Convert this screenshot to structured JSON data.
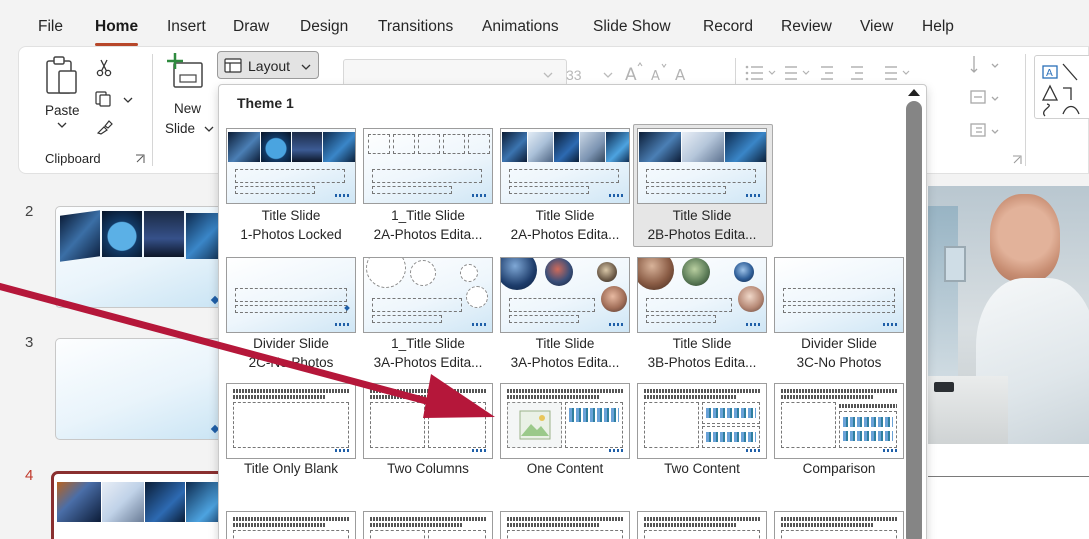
{
  "menu": {
    "tabs": [
      "File",
      "Home",
      "Insert",
      "Draw",
      "Design",
      "Transitions",
      "Animations",
      "Slide Show",
      "Record",
      "Review",
      "View",
      "Help"
    ]
  },
  "ribbon": {
    "paste_label": "Paste",
    "clipboard_group": "Clipboard",
    "new_slide_line1": "New",
    "new_slide_line2": "Slide",
    "layout_button": "Layout",
    "font_size": "33"
  },
  "slides": [
    {
      "number": "2",
      "active": false
    },
    {
      "number": "3",
      "active": false
    },
    {
      "number": "4",
      "active": true
    }
  ],
  "layout_menu": {
    "theme_title": "Theme 1",
    "rows": [
      [
        {
          "line1": "Title Slide",
          "line2": "1-Photos Locked"
        },
        {
          "line1": "1_Title Slide",
          "line2": "2A-Photos Edita..."
        },
        {
          "line1": "Title Slide",
          "line2": "2A-Photos Edita..."
        },
        {
          "line1": "Title Slide",
          "line2": "2B-Photos Edita...",
          "selected": true
        }
      ],
      [
        {
          "line1": "Divider Slide",
          "line2": "2C-No Photos"
        },
        {
          "line1": "1_Title Slide",
          "line2": "3A-Photos Edita..."
        },
        {
          "line1": "Title Slide",
          "line2": "3A-Photos Edita..."
        },
        {
          "line1": "Title Slide",
          "line2": "3B-Photos Edita..."
        },
        {
          "line1": "Divider Slide",
          "line2": "3C-No Photos"
        }
      ],
      [
        {
          "line1": "Title Only Blank"
        },
        {
          "line1": "Two Columns"
        },
        {
          "line1": "One Content"
        },
        {
          "line1": "Two Content"
        },
        {
          "line1": "Comparison"
        }
      ]
    ]
  },
  "colors": {
    "accent": "#b7472a",
    "annotation_arrow": "#b5173a",
    "slide_blue": "#1f5fa8"
  }
}
